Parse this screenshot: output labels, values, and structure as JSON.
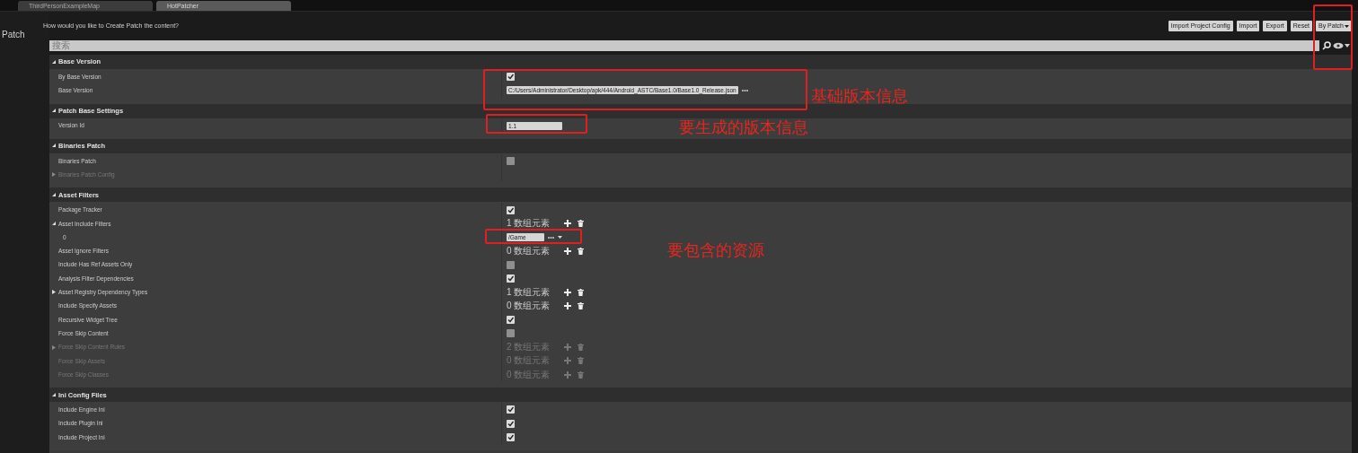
{
  "tabs": [
    {
      "label": "ThirdPersonExampleMap",
      "selected": false
    },
    {
      "label": "HotPatcher",
      "selected": true
    }
  ],
  "panel": {
    "title": "Patch",
    "prompt": "How would you like to Create Patch the content?",
    "buttons": [
      "Import Project Config",
      "Import",
      "Export",
      "Reset"
    ],
    "mode_dropdown": "By Patch"
  },
  "search": {
    "placeholder": "搜索"
  },
  "sections": [
    {
      "title": "Base Version",
      "expanded": true,
      "rows": [
        {
          "kind": "checkbox",
          "label": "By Base Version",
          "checked": true,
          "disabled": false
        },
        {
          "kind": "path",
          "label": "Base Version",
          "value": "C:/Users/Administrator/Desktop/apk/444/Android_ASTC/Base1.0/Base1.0_Release.json",
          "disabled": false
        }
      ]
    },
    {
      "title": "Patch Base Settings",
      "expanded": true,
      "rows": [
        {
          "kind": "text",
          "label": "Version Id",
          "value": "1.1",
          "disabled": false
        }
      ]
    },
    {
      "title": "Binaries Patch",
      "expanded": true,
      "rows": [
        {
          "kind": "checkbox",
          "label": "Binaries Patch",
          "checked": false,
          "disabled": false
        },
        {
          "kind": "group",
          "label": "Binaries Patch Config",
          "expanded": false,
          "disabled": true
        }
      ]
    },
    {
      "title": "Asset Filters",
      "expanded": true,
      "rows": [
        {
          "kind": "checkbox",
          "label": "Package Tracker",
          "checked": true,
          "disabled": false
        },
        {
          "kind": "array",
          "label": "Asset Include Filters",
          "count": "1 数组元素",
          "expanded": true,
          "disabled": false
        },
        {
          "kind": "array_item",
          "label": "0",
          "value": "/Game",
          "disabled": false
        },
        {
          "kind": "array",
          "label": "Asset Ignore Filters",
          "count": "0 数组元素",
          "disabled": false
        },
        {
          "kind": "checkbox",
          "label": "Include Has Ref Assets Only",
          "checked": false,
          "disabled": false
        },
        {
          "kind": "checkbox",
          "label": "Analysis Filter Dependencies",
          "checked": true,
          "disabled": false
        },
        {
          "kind": "array",
          "label": "Asset Registry Dependency Types",
          "count": "1 数组元素",
          "expanded": false,
          "disabled": false
        },
        {
          "kind": "array",
          "label": "Include Specify Assets",
          "count": "0 数组元素",
          "disabled": false
        },
        {
          "kind": "checkbox",
          "label": "Recursive Widget Tree",
          "checked": true,
          "disabled": false
        },
        {
          "kind": "checkbox",
          "label": "Force Skip Content",
          "checked": false,
          "disabled": false
        },
        {
          "kind": "array",
          "label": "Force Skip Content Rules",
          "count": "2 数组元素",
          "expanded": false,
          "disabled": true
        },
        {
          "kind": "array",
          "label": "Force Skip Assets",
          "count": "0 数组元素",
          "disabled": true
        },
        {
          "kind": "array",
          "label": "Force Skip Classes",
          "count": "0 数组元素",
          "disabled": true
        }
      ]
    },
    {
      "title": "Ini Config Files",
      "expanded": true,
      "rows": [
        {
          "kind": "checkbox",
          "label": "Include Engine Ini",
          "checked": true,
          "disabled": false
        },
        {
          "kind": "checkbox",
          "label": "Include Plugin Ini",
          "checked": true,
          "disabled": false
        },
        {
          "kind": "checkbox",
          "label": "Include Project Ini",
          "checked": true,
          "disabled": false
        }
      ]
    }
  ],
  "annotations": [
    {
      "text": "基础版本信息"
    },
    {
      "text": "要生成的版本信息"
    },
    {
      "text": "要包含的资源"
    }
  ]
}
